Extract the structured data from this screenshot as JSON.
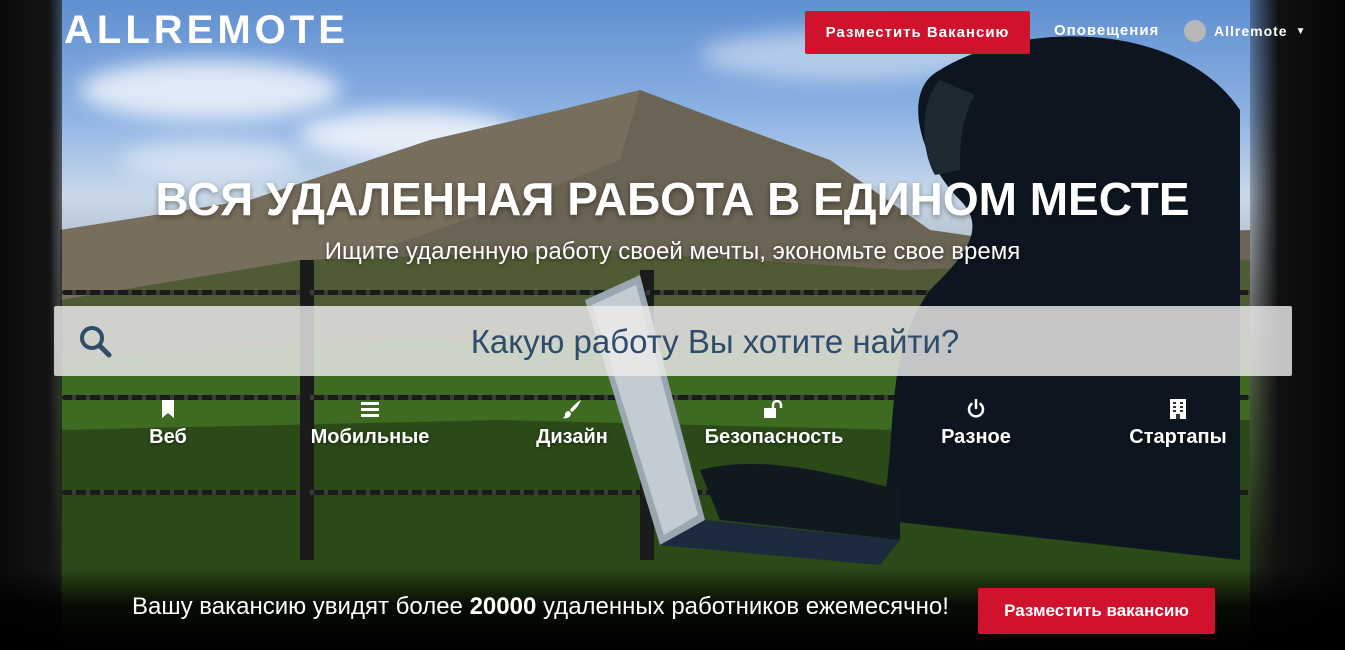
{
  "header": {
    "logo": "ALLREMOTE",
    "post_job_label": "Разместить Вакансию",
    "notifications_label": "Оповещения",
    "user_name": "Allremote"
  },
  "hero": {
    "title": "ВСЯ УДАЛЕННАЯ РАБОТА В ЕДИНОМ МЕСТЕ",
    "subtitle": "Ищите удаленную работу своей мечты, экономьте свое время"
  },
  "search": {
    "placeholder": "Какую работу Вы хотите найти?",
    "icon": "search-icon"
  },
  "categories": [
    {
      "label": "Веб",
      "icon": "bookmark-icon"
    },
    {
      "label": "Мобильные",
      "icon": "bars-icon"
    },
    {
      "label": "Дизайн",
      "icon": "paintbrush-icon"
    },
    {
      "label": "Безопасность",
      "icon": "unlock-icon"
    },
    {
      "label": "Разное",
      "icon": "power-icon"
    },
    {
      "label": "Стартапы",
      "icon": "building-icon"
    }
  ],
  "promo": {
    "text_before": "Вашу вакансию увидят более ",
    "count": "20000",
    "text_after": " удаленных работников ежемесячно!",
    "button_label": "Разместить вакансию"
  },
  "colors": {
    "accent_red": "#d0122c",
    "search_text": "#2f4c6a"
  }
}
